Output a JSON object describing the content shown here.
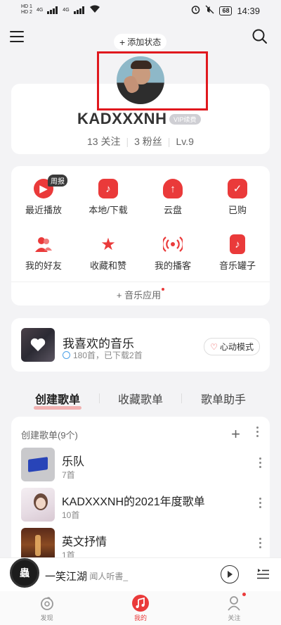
{
  "status_bar": {
    "sim1": "HD 1",
    "sim2": "HD 2",
    "net1": "4G",
    "net2": "4G",
    "battery": "68",
    "time": "14:39"
  },
  "header": {
    "add_status": "添加状态"
  },
  "profile": {
    "username": "KADXXXNH",
    "vip_badge": "VIP续费",
    "following": "13 关注",
    "followers": "3 粉丝",
    "level": "Lv.9"
  },
  "quick_actions": {
    "hot_tag": "周报",
    "items": [
      {
        "label": "最近播放",
        "icon": "recent-play-icon"
      },
      {
        "label": "本地/下载",
        "icon": "local-download-icon"
      },
      {
        "label": "云盘",
        "icon": "cloud-upload-icon"
      },
      {
        "label": "已购",
        "icon": "purchased-icon"
      },
      {
        "label": "我的好友",
        "icon": "friends-icon"
      },
      {
        "label": "收藏和赞",
        "icon": "star-icon"
      },
      {
        "label": "我的播客",
        "icon": "podcast-icon"
      },
      {
        "label": "音乐罐子",
        "icon": "music-jar-icon"
      }
    ],
    "music_app": "音乐应用"
  },
  "liked_music": {
    "title": "我喜欢的音乐",
    "subtitle": "180首，已下载2首",
    "heart_mode": "心动模式"
  },
  "tabs": [
    "创建歌单",
    "收藏歌单",
    "歌单助手"
  ],
  "playlists": {
    "header": "创建歌单(9个)",
    "items": [
      {
        "title": "乐队",
        "count": "7首"
      },
      {
        "title": "KADXXXNH的2021年度歌单",
        "count": "10首"
      },
      {
        "title": "英文抒情",
        "count": "1首"
      }
    ]
  },
  "player": {
    "title": "一笑江湖",
    "artist": "- 闻人听書_"
  },
  "bottom_nav": [
    {
      "label": "发现",
      "icon": "discover-icon"
    },
    {
      "label": "我的",
      "icon": "my-music-icon"
    },
    {
      "label": "关注",
      "icon": "follow-icon"
    }
  ],
  "colors": {
    "accent": "#ea3a3a",
    "highlight_box": "#e0181e"
  }
}
